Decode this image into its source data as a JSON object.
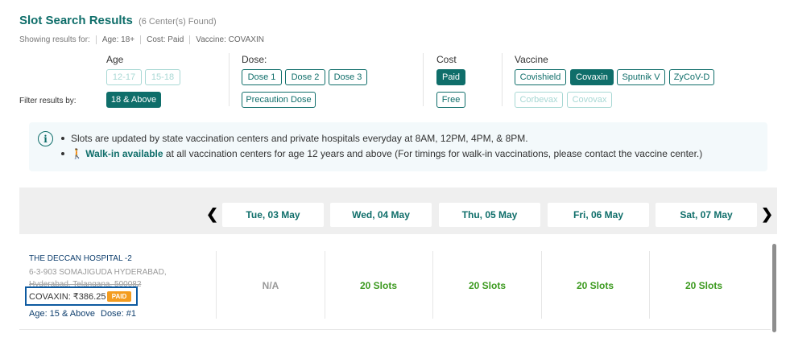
{
  "header": {
    "title": "Slot Search Results",
    "count": "(6 Center(s) Found)"
  },
  "showing": {
    "label": "Showing results for:",
    "age": "Age: 18+",
    "cost": "Cost: Paid",
    "vaccine": "Vaccine: COVAXIN"
  },
  "filters": {
    "label": "Filter results by:",
    "age": {
      "title": "Age",
      "options": [
        "12-17",
        "15-18",
        "18 & Above"
      ],
      "selected": "18 & Above"
    },
    "dose": {
      "title": "Dose:",
      "options": [
        "Dose 1",
        "Dose 2",
        "Dose 3",
        "Precaution Dose"
      ]
    },
    "cost": {
      "title": "Cost",
      "options": [
        "Paid",
        "Free"
      ],
      "selected": "Paid"
    },
    "vaccine": {
      "title": "Vaccine",
      "options": [
        "Covishield",
        "Covaxin",
        "Sputnik V",
        "ZyCoV-D",
        "Corbevax",
        "Covovax"
      ],
      "selected": "Covaxin"
    }
  },
  "info": {
    "line1": "Slots are updated by state vaccination centers and private hospitals everyday at 8AM, 12PM, 4PM, & 8PM.",
    "walkin_label": "Walk-in available",
    "line2_rest": " at all vaccination centers for age 12 years and above (For timings for walk-in vaccinations, please contact the vaccine center.)"
  },
  "dates": [
    "Tue, 03 May",
    "Wed, 04 May",
    "Thu, 05 May",
    "Fri, 06 May",
    "Sat, 07 May"
  ],
  "center": {
    "name": "THE DECCAN HOSPITAL -2",
    "address_line1": "6-3-903 SOMAJIGUDA HYDERABAD,",
    "address_line2": "Hyderabad, Telangana, 500082",
    "vaccine_price": "COVAXIN: ₹386.25",
    "badge": "PAID",
    "age": "Age: 15 & Above",
    "dose": "Dose: #1",
    "slots": [
      "N/A",
      "20 Slots",
      "20 Slots",
      "20 Slots",
      "20 Slots"
    ]
  },
  "colors": {
    "accent": "#0f6e6a",
    "slots_green": "#3c9a1f",
    "badge_orange": "#f39c1f",
    "highlight_box": "#0d5aa0"
  }
}
